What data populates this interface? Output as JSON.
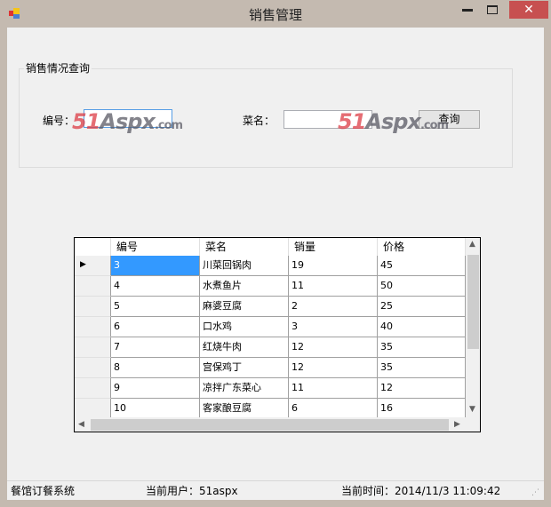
{
  "window": {
    "title": "销售管理",
    "close": "✕"
  },
  "query_group": {
    "title": "销售情况查询",
    "id_label": "编号：",
    "id_value": "",
    "name_label": "菜名：",
    "name_value": "",
    "search_button": "查询"
  },
  "watermark": "51Aspx.com",
  "grid": {
    "columns": [
      "编号",
      "菜名",
      "销量",
      "价格"
    ],
    "rows": [
      [
        "3",
        "川菜回锅肉",
        "19",
        "45"
      ],
      [
        "4",
        "水煮鱼片",
        "11",
        "50"
      ],
      [
        "5",
        "麻婆豆腐",
        "2",
        "25"
      ],
      [
        "6",
        "口水鸡",
        "3",
        "40"
      ],
      [
        "7",
        "红烧牛肉",
        "12",
        "35"
      ],
      [
        "8",
        "宫保鸡丁",
        "12",
        "35"
      ],
      [
        "9",
        "凉拌广东菜心",
        "11",
        "12"
      ],
      [
        "10",
        "客家酿豆腐",
        "6",
        "16"
      ]
    ],
    "selected_row": 0
  },
  "status": {
    "app": "餐馆订餐系统",
    "user": "当前用户：51aspx",
    "time": "当前时间：2014/11/3 11:09:42"
  }
}
